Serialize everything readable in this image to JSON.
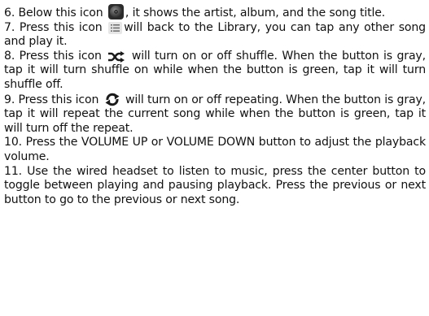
{
  "instructions": [
    {
      "number": "6.",
      "before_icon": "Below this icon",
      "icon": "album-disc-icon",
      "after_icon": ", it shows the artist, album, and the song title."
    },
    {
      "number": "7.",
      "before_icon": "Press this icon",
      "icon": "library-list-icon",
      "after_icon": "will back to the Library, you can tap any other song and play it."
    },
    {
      "number": "8.",
      "before_icon": "Press this icon",
      "icon": "shuffle-icon",
      "after_icon": "will turn on or off shuffle. When the button is gray, tap it will turn shuffle on while when the button is green, tap it will turn shuffle off."
    },
    {
      "number": "9.",
      "before_icon": "Press this icon",
      "icon": "repeat-icon",
      "after_icon": "will turn on or off repeating. When the button is gray, tap it will repeat the current song while when the button is green, tap it will turn off the repeat."
    },
    {
      "number": "10.",
      "text": "Press the VOLUME UP or VOLUME DOWN button to adjust the playback volume."
    },
    {
      "number": "11.",
      "text": "Use the wired headset to listen to music, press the center button to toggle between playing and pausing playback. Press the previous or next button to go to the previous or next song."
    }
  ],
  "colors": {
    "text": "#111111",
    "icon_dark": "#1a1a1a",
    "disc": "#4a4a4a"
  }
}
